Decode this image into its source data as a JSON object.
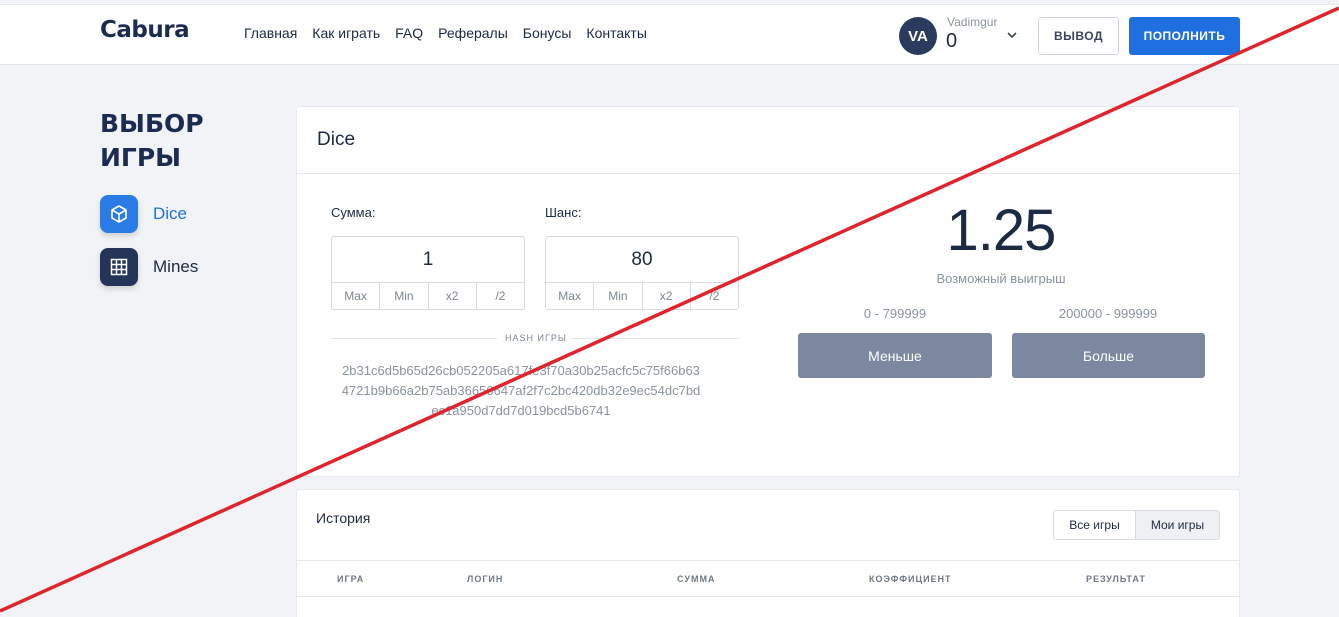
{
  "header": {
    "logo": "Cabura",
    "nav": [
      "Главная",
      "Как играть",
      "FAQ",
      "Рефералы",
      "Бонусы",
      "Контакты"
    ],
    "user": {
      "initials": "VA",
      "name": "Vadimgur",
      "balance": "0"
    },
    "withdraw_label": "ВЫВОД",
    "deposit_label": "ПОПОЛНИТЬ"
  },
  "sidebar": {
    "title": "ВЫБОР ИГРЫ",
    "games": [
      {
        "label": "Dice",
        "icon": "cube-icon",
        "active": true
      },
      {
        "label": "Mines",
        "icon": "grid-icon",
        "active": false
      }
    ]
  },
  "game": {
    "title": "Dice",
    "sum": {
      "label": "Сумма:",
      "value": "1",
      "mods": [
        "Max",
        "Min",
        "x2",
        "/2"
      ]
    },
    "chance": {
      "label": "Шанс:",
      "value": "80",
      "mods": [
        "Max",
        "Min",
        "x2",
        "/2"
      ]
    },
    "hash": {
      "title": "HASH ИГРЫ",
      "value": "2b31c6d5b65d26cb052205a617fe3f70a30b25acfc5c75f66b634721b9b66a2b75ab36656647af2f7c2bc420db32e9ec54dc7bdec1a950d7dd7d019bcd5b6741"
    },
    "win": {
      "value": "1.25",
      "label": "Возможный выигрыш"
    },
    "less": {
      "range": "0 - 799999",
      "label": "Меньше"
    },
    "more": {
      "range": "200000 - 999999",
      "label": "Больше"
    }
  },
  "history": {
    "title": "История",
    "filters": [
      "Все игры",
      "Мои игры"
    ],
    "columns": [
      "ИГРА",
      "ЛОГИН",
      "СУММА",
      "КОЭФФИЦИЕНТ",
      "РЕЗУЛЬТАТ"
    ]
  },
  "colors": {
    "accent": "#1f6fe0",
    "bet_button": "#7c889f",
    "overlay_line": "#e0242d"
  }
}
